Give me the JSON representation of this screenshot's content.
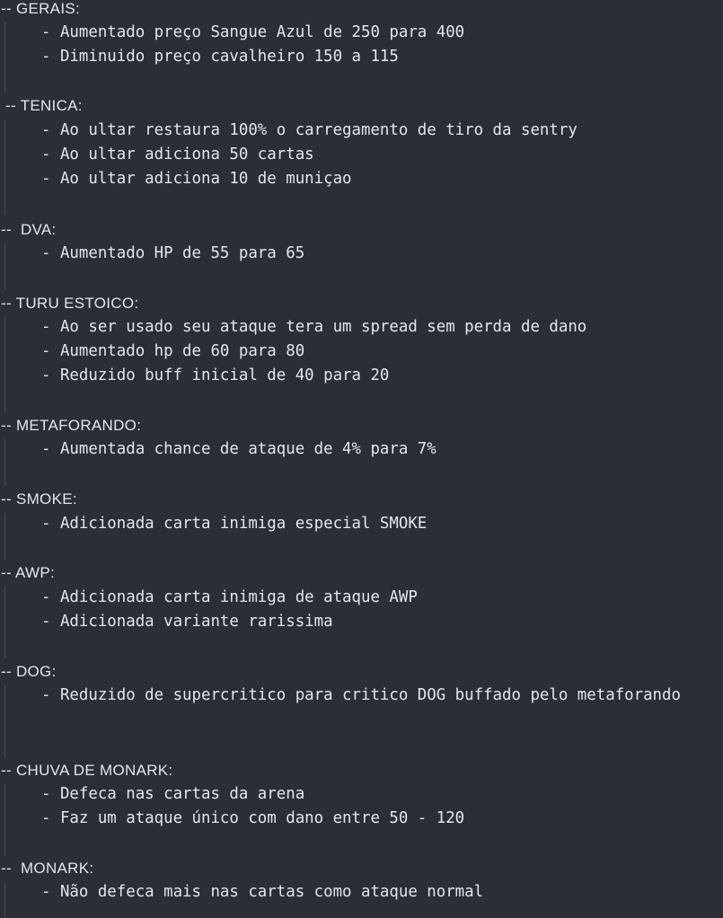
{
  "document": {
    "sections": [
      {
        "heading": "-- GERAIS:",
        "items": [
          "- Aumentado preço Sangue Azul de 250 para 400",
          "- Diminuido preço cavalheiro 150 a 115"
        ]
      },
      {
        "heading": " -- TENICA:",
        "items": [
          "- Ao ultar restaura 100% o carregamento de tiro da sentry",
          "- Ao ultar adiciona 50 cartas",
          "- Ao ultar adiciona 10 de muniçao"
        ]
      },
      {
        "heading": "--  DVA:",
        "items": [
          "- Aumentado HP de 55 para 65"
        ]
      },
      {
        "heading": "-- TURU ESTOICO:",
        "items": [
          "- Ao ser usado seu ataque tera um spread sem perda de dano",
          "- Aumentado hp de 60 para 80",
          "- Reduzido buff inicial de 40 para 20"
        ]
      },
      {
        "heading": "-- METAFORANDO:",
        "items": [
          "- Aumentada chance de ataque de 4% para 7%"
        ]
      },
      {
        "heading": "-- SMOKE:",
        "items": [
          "- Adicionada carta inimiga especial SMOKE"
        ]
      },
      {
        "heading": "-- AWP:",
        "items": [
          "- Adicionada carta inimiga de ataque AWP",
          "- Adicionada variante rarissima"
        ]
      },
      {
        "heading": "-- DOG:",
        "items": [
          "- Reduzido de supercritico para critico DOG buffado pelo metaforando"
        ]
      },
      {
        "heading": "-- CHUVA DE MONARK:",
        "items": [
          "- Defeca nas cartas da arena",
          "- Faz um ataque único com dano entre 50 - 120"
        ]
      },
      {
        "heading": "--  MONARK:",
        "items": [
          "- Não defeca mais nas cartas como ataque normal"
        ]
      }
    ]
  }
}
